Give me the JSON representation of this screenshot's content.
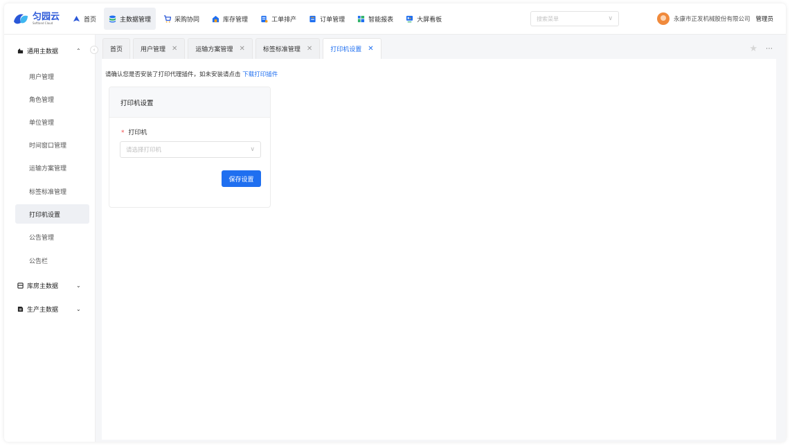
{
  "brand": {
    "name_cn": "匀园云",
    "name_en": "Softland Cloud"
  },
  "nav": [
    {
      "label": "首页",
      "icon": "home-icon",
      "active": false
    },
    {
      "label": "主数据管理",
      "icon": "database-icon",
      "active": true
    },
    {
      "label": "采购协同",
      "icon": "cart-icon",
      "active": false
    },
    {
      "label": "库存管理",
      "icon": "warehouse-icon",
      "active": false
    },
    {
      "label": "工单排产",
      "icon": "workorder-icon",
      "active": false
    },
    {
      "label": "订单管理",
      "icon": "order-icon",
      "active": false
    },
    {
      "label": "智能报表",
      "icon": "report-icon",
      "active": false
    },
    {
      "label": "大屏看板",
      "icon": "dashboard-icon",
      "active": false
    }
  ],
  "search": {
    "placeholder": "搜索菜单"
  },
  "user": {
    "company": "永康市正发机械股份有限公司",
    "role": "管理员"
  },
  "sidebar": {
    "groups": [
      {
        "label": "通用主数据",
        "icon": "stand-icon",
        "expanded": true,
        "items": [
          {
            "label": "用户管理",
            "active": false
          },
          {
            "label": "角色管理",
            "active": false
          },
          {
            "label": "单位管理",
            "active": false
          },
          {
            "label": "时间窗口管理",
            "active": false
          },
          {
            "label": "运输方案管理",
            "active": false
          },
          {
            "label": "标签标准管理",
            "active": false
          },
          {
            "label": "打印机设置",
            "active": true
          },
          {
            "label": "公告管理",
            "active": false
          },
          {
            "label": "公告栏",
            "active": false
          }
        ]
      },
      {
        "label": "库房主数据",
        "icon": "storage-icon",
        "expanded": false
      },
      {
        "label": "生产主数据",
        "icon": "production-icon",
        "expanded": false
      }
    ]
  },
  "tabs": [
    {
      "label": "首页",
      "closable": false,
      "active": false
    },
    {
      "label": "用户管理",
      "closable": true,
      "active": false
    },
    {
      "label": "运输方案管理",
      "closable": true,
      "active": false
    },
    {
      "label": "标签标准管理",
      "closable": true,
      "active": false
    },
    {
      "label": "打印机设置",
      "closable": true,
      "active": true
    }
  ],
  "notice": {
    "text": "请确认您是否安装了打印代理插件，如未安装请点击",
    "link": "下载打印插件"
  },
  "card": {
    "title": "打印机设置",
    "field_label": "打印机",
    "required_mark": "*",
    "select_placeholder": "请选择打印机",
    "save_label": "保存设置"
  },
  "colors": {
    "primary": "#1f6ff0",
    "required": "#f04a4a",
    "active_bg": "#eef0f4"
  }
}
